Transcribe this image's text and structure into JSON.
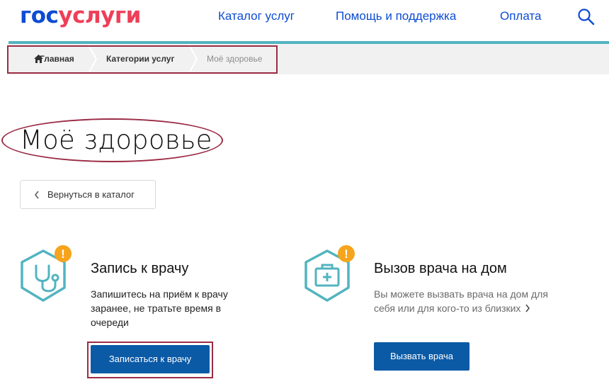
{
  "header": {
    "logo": {
      "part1": "гос",
      "part2": "услуги"
    },
    "nav": [
      {
        "label": "Каталог услуг"
      },
      {
        "label": "Помощь и поддержка"
      },
      {
        "label": "Оплата"
      }
    ],
    "search_icon": "search-icon"
  },
  "breadcrumb": {
    "items": [
      {
        "label": "Главная",
        "icon": "home-icon"
      },
      {
        "label": "Категории услуг"
      },
      {
        "label": "Моё здоровье"
      }
    ]
  },
  "page": {
    "title": "Моё здоровье",
    "back_button": "Вернуться в каталог"
  },
  "services": [
    {
      "icon": "stethoscope-icon",
      "badge": "!",
      "title": "Запись к врачу",
      "description": "Запишитесь на приём к врачу заранее, не тратьте время в очереди",
      "button": "Записаться к врачу"
    },
    {
      "icon": "medical-kit-icon",
      "badge": "!",
      "title": "Вызов врача на дом",
      "description": "Вы можете вызвать врача на дом для себя или для кого-то из близких",
      "button": "Вызвать врача"
    }
  ],
  "colors": {
    "brand_blue": "#0d4cd3",
    "brand_red": "#ee3f58",
    "accent_teal": "#52b4bf",
    "button_blue": "#0b5aa6",
    "badge_orange": "#f7a41d",
    "annotation": "#9b2c45"
  }
}
